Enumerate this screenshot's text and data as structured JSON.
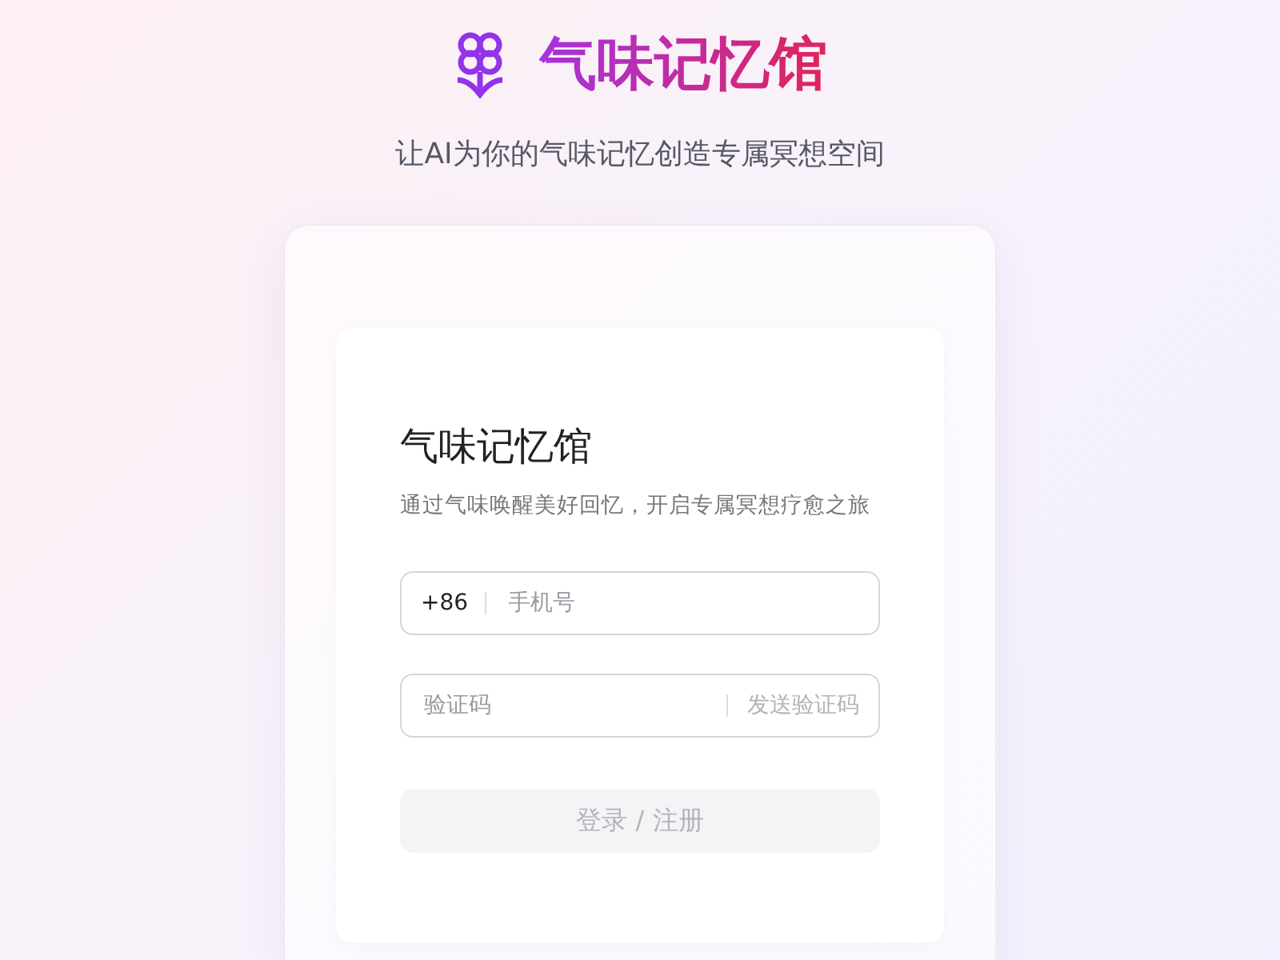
{
  "header": {
    "title": "气味记忆馆",
    "subtitle": "让AI为你的气味记忆创造专属冥想空间"
  },
  "login": {
    "title": "气味记忆馆",
    "description": "通过气味唤醒美好回忆，开启专属冥想疗愈之旅",
    "phone": {
      "prefix": "+86",
      "placeholder": "手机号"
    },
    "code": {
      "placeholder": "验证码",
      "send_button": {
        "label": "发送验证码",
        "disabled": true
      }
    },
    "submit": {
      "label": "登录 / 注册",
      "disabled": true
    }
  }
}
